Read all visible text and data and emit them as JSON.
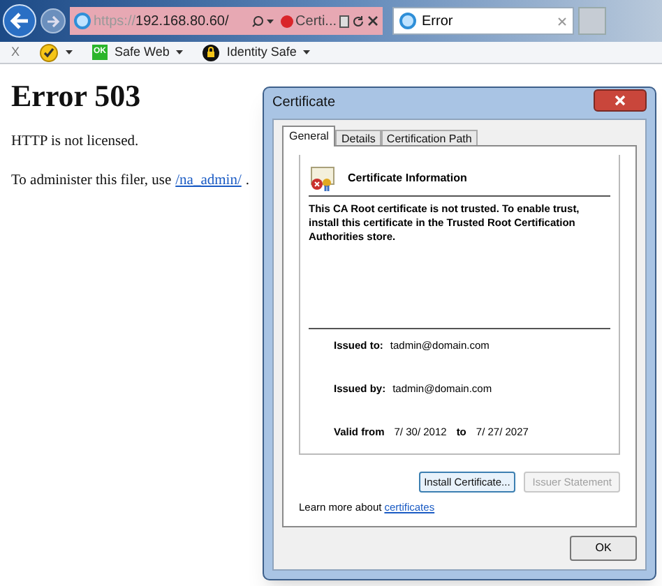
{
  "browser": {
    "address": {
      "prefix": "https://",
      "host": "192.168.80.60/"
    },
    "address_tab": {
      "label": "Certi..."
    },
    "tab": {
      "title": "Error"
    },
    "toolbar": [
      {
        "kind": "close",
        "label": "X"
      },
      {
        "kind": "norton"
      },
      {
        "kind": "safeweb",
        "badge": "OK",
        "label": "Safe Web"
      },
      {
        "kind": "identity",
        "label": "Identity Safe"
      }
    ]
  },
  "page": {
    "heading": "Error 503",
    "line_1": "HTTP is not licensed.",
    "line_2": "To administer this filer, use",
    "link": "/na_admin/",
    "line_2_end": "."
  },
  "dialog": {
    "title": "Certificate",
    "tabs": [
      {
        "label": "General",
        "selected": true
      },
      {
        "label": "Details",
        "selected": false
      },
      {
        "label": "Certification Path",
        "selected": false
      }
    ],
    "info_title": "Certificate Information",
    "warning": "This CA Root certificate is not trusted. To enable trust, install this certificate in the Trusted Root Certification Authorities store.",
    "issued_to_label": "Issued to:",
    "issued_to": "tadmin@domain.com",
    "issued_by_label": "Issued by:",
    "issued_by": "tadmin@domain.com",
    "valid_from_label": "Valid from",
    "valid_from": "7/ 30/ 2012",
    "to_label": "to",
    "valid_to": "7/ 27/ 2027",
    "buttons": [
      {
        "label": "Install Certificate...",
        "disabled": false
      },
      {
        "label": "Issuer Statement",
        "disabled": true
      }
    ],
    "learn_more": "Learn more about",
    "learn_link": "certificates",
    "ok": "OK"
  }
}
